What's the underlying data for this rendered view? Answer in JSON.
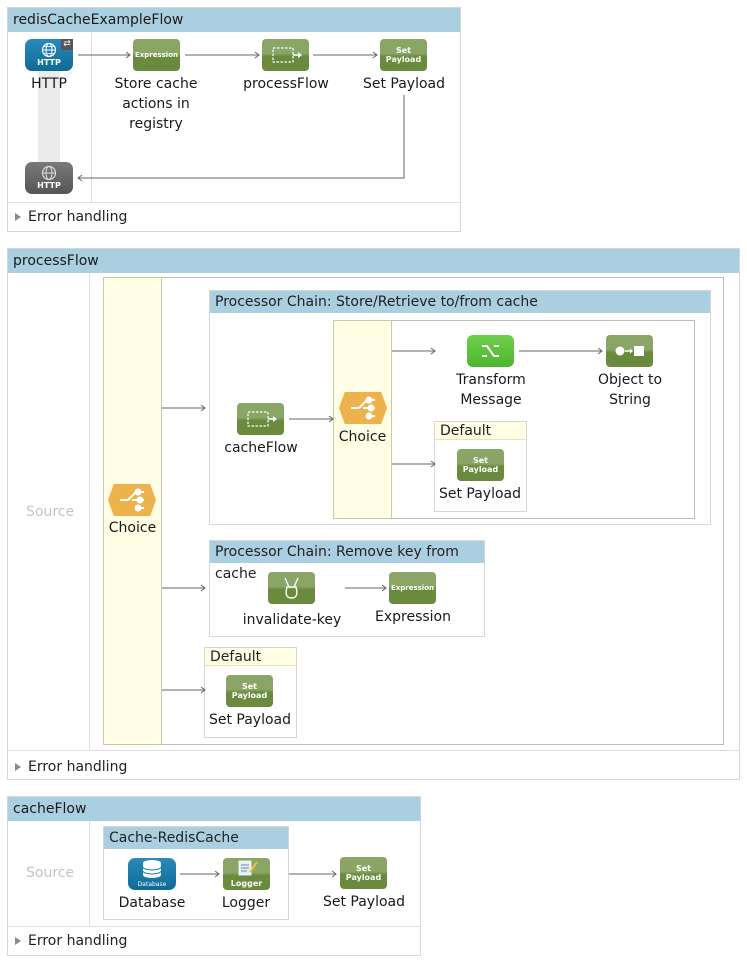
{
  "flows": {
    "redis": {
      "title": "redisCacheExampleFlow",
      "nodes": {
        "http": {
          "label": "HTTP",
          "icon_text": "HTTP"
        },
        "http_response": {
          "icon_text": "HTTP"
        },
        "store": {
          "label_lines": [
            "Store cache",
            "actions in",
            "registry"
          ],
          "icon_text": "Expression"
        },
        "process": {
          "label": "processFlow"
        },
        "setpayload": {
          "label": "Set Payload",
          "icon_text": [
            "Set",
            "Payload"
          ]
        }
      },
      "error_handling": "Error handling"
    },
    "process": {
      "title": "processFlow",
      "source_label": "Source",
      "choice": {
        "label": "Choice"
      },
      "chain1": {
        "title": "Processor Chain: Store/Retrieve to/from cache",
        "cacheflow": {
          "label": "cacheFlow"
        },
        "choice": {
          "label": "Choice"
        },
        "transform": {
          "label_lines": [
            "Transform",
            "Message"
          ]
        },
        "objstr": {
          "label_lines": [
            "Object to",
            "String"
          ]
        },
        "default": {
          "title": "Default",
          "setpayload": {
            "label": "Set Payload",
            "icon_text": [
              "Set",
              "Payload"
            ]
          }
        }
      },
      "chain2": {
        "title": "Processor Chain: Remove key from cache",
        "invalidate": {
          "label": "invalidate-key"
        },
        "expression": {
          "label": "Expression",
          "icon_text": "Expression"
        }
      },
      "default": {
        "title": "Default",
        "setpayload": {
          "label": "Set Payload",
          "icon_text": [
            "Set",
            "Payload"
          ]
        }
      },
      "error_handling": "Error handling"
    },
    "cache": {
      "title": "cacheFlow",
      "source_label": "Source",
      "scope": {
        "title": "Cache-RedisCache",
        "database": {
          "label": "Database",
          "icon_text": "Database"
        },
        "logger": {
          "label": "Logger",
          "icon_text": "Logger"
        }
      },
      "setpayload": {
        "label": "Set Payload",
        "icon_text": [
          "Set",
          "Payload"
        ]
      },
      "error_handling": "Error handling"
    }
  },
  "colors": {
    "header_blue": "#a9cfe1",
    "http_blue": "#1a7aa6",
    "processor_green": "#6a8a3e",
    "transform_green": "#5cc13c",
    "choice_orange": "#eeb24c",
    "choice_lane": "#fffde3"
  }
}
